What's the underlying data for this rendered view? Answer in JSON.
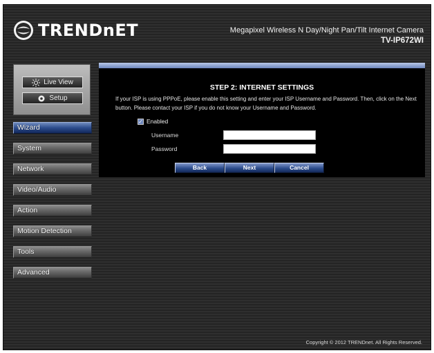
{
  "header": {
    "logo_text": "TRENDnET",
    "product_name": "Megapixel Wireless N Day/Night Pan/Tilt Internet Camera",
    "model": "TV-IP672WI"
  },
  "side_panel": {
    "live_view_label": "Live View",
    "setup_label": "Setup"
  },
  "nav": {
    "items": [
      {
        "label": "Wizard",
        "active": true
      },
      {
        "label": "System"
      },
      {
        "label": "Network"
      },
      {
        "label": "Video/Audio"
      },
      {
        "label": "Action"
      },
      {
        "label": "Motion Detection"
      },
      {
        "label": "Tools"
      },
      {
        "label": "Advanced"
      }
    ]
  },
  "wizard": {
    "step_title": "STEP 2: INTERNET SETTINGS",
    "instructions": "If your ISP is using PPPoE, please enable this setting and enter your ISP Username and Password. Then, click on the Next button. Please contact your ISP if you do not know your Username and Password.",
    "enabled_label": "Enabled",
    "enabled_checked": true,
    "username_label": "Username",
    "username_value": "",
    "password_label": "Password",
    "password_value": "",
    "back_label": "Back",
    "next_label": "Next",
    "cancel_label": "Cancel"
  },
  "footer": {
    "copyright": "Copyright © 2012 TRENDnet. All Rights Reserved."
  },
  "colors": {
    "accent_blue": "#2c4c8c",
    "background": "#2a2a2a",
    "content_bg": "#000000"
  }
}
